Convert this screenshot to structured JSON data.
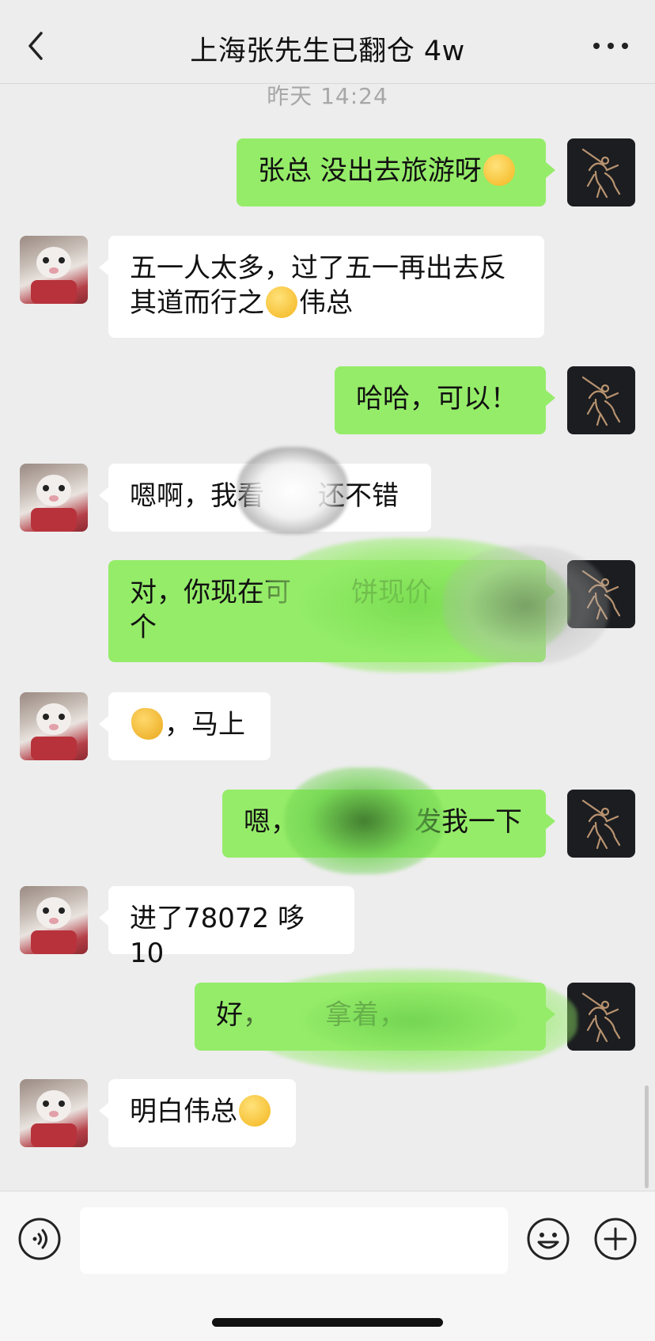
{
  "header": {
    "title": "上海张先生已翻仓 4w"
  },
  "timestamp": "昨天 14:24",
  "messages": [
    {
      "from": "me",
      "text": "张总 没出去旅游呀",
      "emoji": "thinking-face"
    },
    {
      "from": "other",
      "line1": "五一人太多，过了五一再出去反",
      "line2_prefix": "其道而行之",
      "emoji": "tears-of-joy",
      "line2_suffix": "伟总"
    },
    {
      "from": "me",
      "text": "哈哈，可以！"
    },
    {
      "from": "other",
      "prefix": "嗯啊，我看",
      "suffix": "还不错"
    },
    {
      "from": "me",
      "line1_a": "对，你现在可",
      "line1_b": "饼现价",
      "line2": "个"
    },
    {
      "from": "other",
      "emoji": "ok-hand",
      "text": "，马上"
    },
    {
      "from": "me",
      "prefix": "嗯，",
      "suffix": "发我一下"
    },
    {
      "from": "other",
      "text": "进了78072 哆10"
    },
    {
      "from": "me",
      "prefix": "好，",
      "middle": "拿着，"
    },
    {
      "from": "other",
      "text": "明白伟总",
      "emoji": "face-with-headband"
    }
  ],
  "input": {
    "value": ""
  },
  "colors": {
    "background": "#ededed",
    "outgoing_bubble": "#95ec69",
    "incoming_bubble": "#ffffff",
    "timestamp": "#a7a7a7"
  },
  "icons": [
    "back-chevron-icon",
    "more-dots-icon",
    "voice-icon",
    "emoji-icon",
    "plus-icon"
  ]
}
